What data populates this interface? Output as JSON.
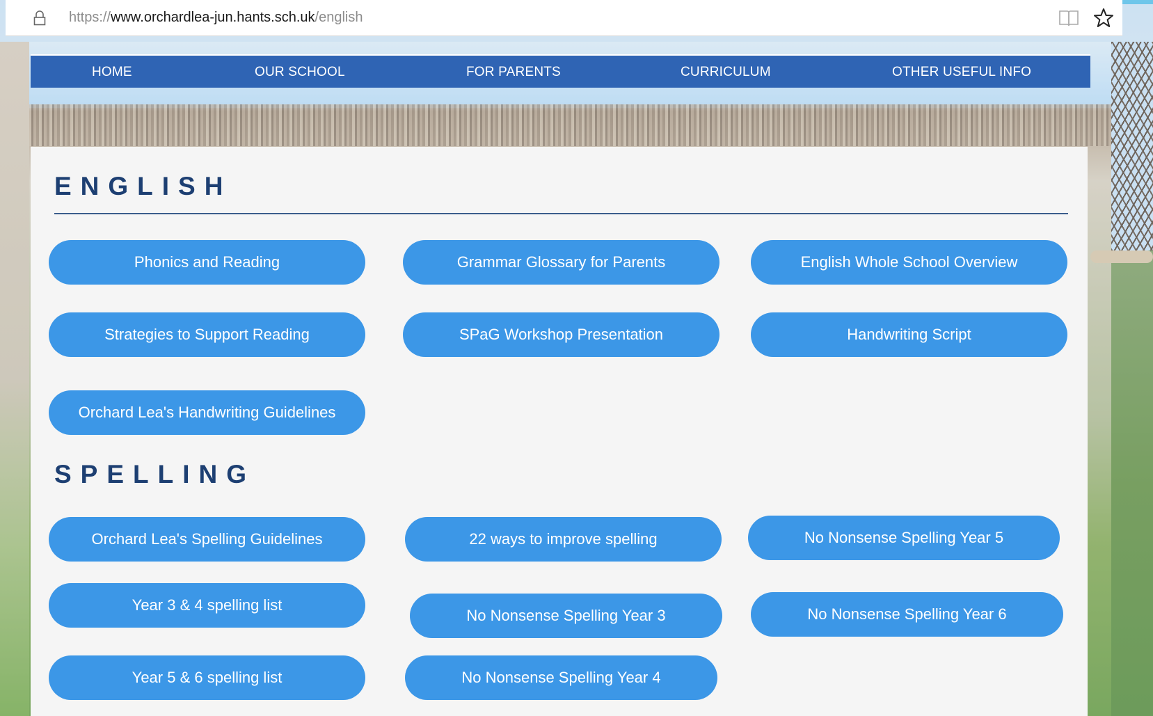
{
  "browser": {
    "url_scheme": "https://",
    "url_host": "www.orchardlea-jun.hants.sch.uk",
    "url_path": "/english",
    "icons": [
      "lock-icon",
      "reader-view-icon",
      "favorite-star-icon"
    ]
  },
  "nav": {
    "items": [
      {
        "label": "HOME"
      },
      {
        "label": "OUR SCHOOL"
      },
      {
        "label": "FOR PARENTS"
      },
      {
        "label": "CURRICULUM"
      },
      {
        "label": "OTHER USEFUL INFO"
      }
    ]
  },
  "english": {
    "title": "ENGLISH",
    "buttons": [
      {
        "label": "Phonics and Reading"
      },
      {
        "label": "Grammar Glossary for Parents"
      },
      {
        "label": "English Whole School Overview"
      },
      {
        "label": "Strategies to Support Reading"
      },
      {
        "label": "SPaG Workshop Presentation"
      },
      {
        "label": "Handwriting Script"
      },
      {
        "label": "Orchard Lea's Handwriting Guidelines"
      }
    ]
  },
  "spelling": {
    "title": "SPELLING",
    "buttons": [
      {
        "label": "Orchard Lea's Spelling Guidelines"
      },
      {
        "label": "22 ways to improve spelling"
      },
      {
        "label": "No Nonsense Spelling Year 5"
      },
      {
        "label": "Year 3 & 4 spelling list"
      },
      {
        "label": "No Nonsense Spelling Year 3"
      },
      {
        "label": "No Nonsense Spelling Year 6"
      },
      {
        "label": "Year 5 & 6 spelling list"
      },
      {
        "label": "No Nonsense Spelling Year 4"
      }
    ]
  },
  "colors": {
    "nav_bg": "#2f64b4",
    "button_bg": "#3c97e7",
    "heading": "#1d3f72",
    "card_bg": "#f5f5f5"
  }
}
